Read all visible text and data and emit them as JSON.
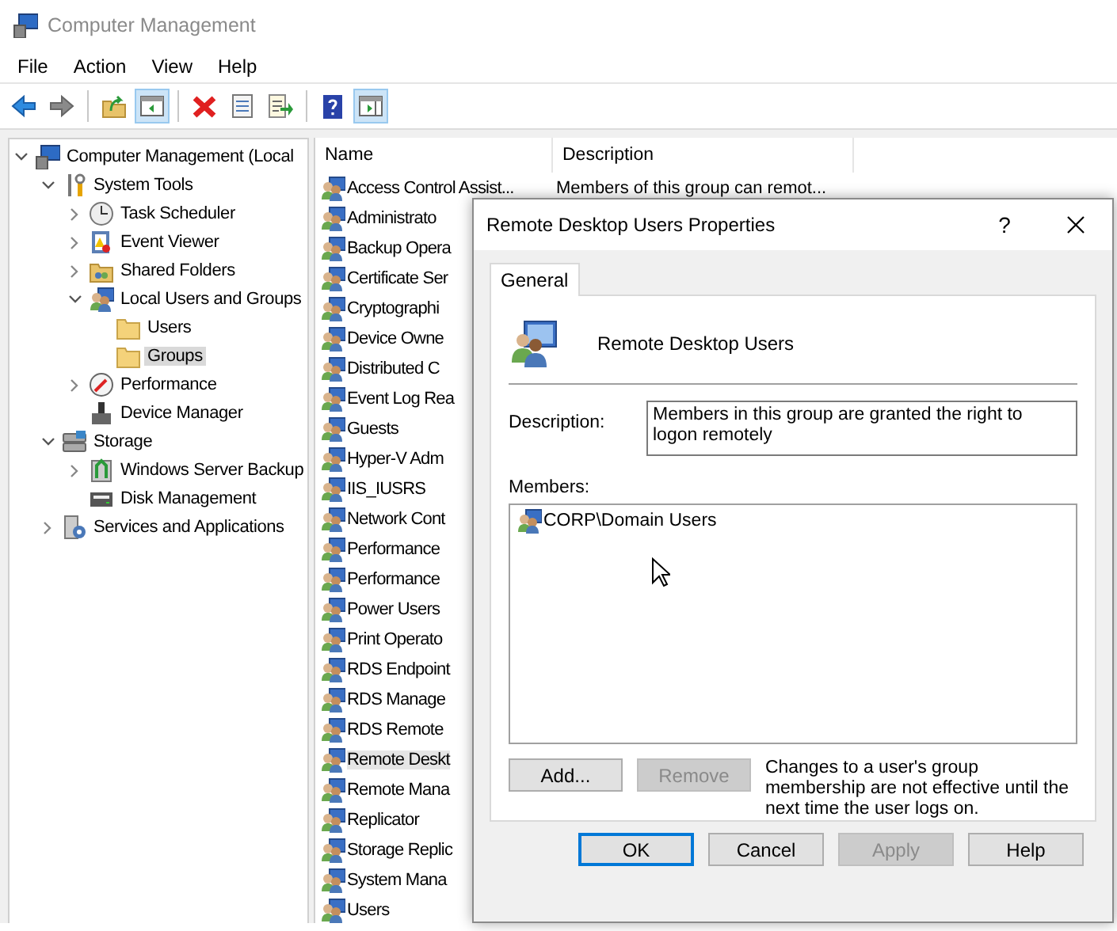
{
  "window": {
    "title": "Computer Management"
  },
  "menu": [
    "File",
    "Action",
    "View",
    "Help"
  ],
  "toolbar": [
    {
      "kind": "back",
      "pressed": false
    },
    {
      "kind": "forward",
      "pressed": false
    },
    {
      "kind": "sep"
    },
    {
      "kind": "up",
      "pressed": false
    },
    {
      "kind": "tree",
      "pressed": true
    },
    {
      "kind": "sep"
    },
    {
      "kind": "delete",
      "pressed": false
    },
    {
      "kind": "properties",
      "pressed": false
    },
    {
      "kind": "export",
      "pressed": false
    },
    {
      "kind": "sep"
    },
    {
      "kind": "help",
      "pressed": false
    },
    {
      "kind": "actions",
      "pressed": true
    }
  ],
  "tree": [
    {
      "label": "Computer Management (Local",
      "kind": "computer",
      "selected": false,
      "expanded": true,
      "children": [
        {
          "label": "System Tools",
          "kind": "tools",
          "selected": false,
          "expanded": true,
          "children": [
            {
              "label": "Task Scheduler",
              "kind": "clock",
              "selected": false,
              "expanded": false
            },
            {
              "label": "Event Viewer",
              "kind": "log",
              "selected": false,
              "expanded": false
            },
            {
              "label": "Shared Folders",
              "kind": "share",
              "selected": false,
              "expanded": false
            },
            {
              "label": "Local Users and Groups",
              "kind": "users",
              "selected": false,
              "expanded": true,
              "children": [
                {
                  "label": "Users",
                  "kind": "folder",
                  "selected": false
                },
                {
                  "label": "Groups",
                  "kind": "folder",
                  "selected": true
                }
              ]
            },
            {
              "label": "Performance",
              "kind": "gauge",
              "selected": false,
              "expanded": false
            },
            {
              "label": "Device Manager",
              "kind": "device",
              "selected": false
            }
          ]
        },
        {
          "label": "Storage",
          "kind": "storage",
          "selected": false,
          "expanded": true,
          "children": [
            {
              "label": "Windows Server Backup",
              "kind": "backup",
              "selected": false,
              "expanded": false
            },
            {
              "label": "Disk Management",
              "kind": "disk",
              "selected": false
            }
          ]
        },
        {
          "label": "Services and Applications",
          "kind": "services",
          "selected": false,
          "expanded": false
        }
      ]
    }
  ],
  "table": {
    "columns": [
      "Name",
      "Description"
    ],
    "rows": [
      {
        "name": "Access Control Assist...",
        "description": "Members of this group can remot...",
        "selected": false
      },
      {
        "name": "Administrato",
        "selected": false
      },
      {
        "name": "Backup Opera",
        "selected": false
      },
      {
        "name": "Certificate Ser",
        "selected": false
      },
      {
        "name": "Cryptographi",
        "selected": false
      },
      {
        "name": "Device Owne",
        "selected": false
      },
      {
        "name": "Distributed C",
        "selected": false
      },
      {
        "name": "Event Log Rea",
        "selected": false
      },
      {
        "name": "Guests",
        "selected": false
      },
      {
        "name": "Hyper-V Adm",
        "selected": false
      },
      {
        "name": "IIS_IUSRS",
        "selected": false
      },
      {
        "name": "Network Cont",
        "selected": false
      },
      {
        "name": "Performance",
        "selected": false
      },
      {
        "name": "Performance",
        "selected": false
      },
      {
        "name": "Power Users",
        "selected": false
      },
      {
        "name": "Print Operato",
        "selected": false
      },
      {
        "name": "RDS Endpoint",
        "selected": false
      },
      {
        "name": "RDS Manage",
        "selected": false
      },
      {
        "name": "RDS Remote",
        "selected": false
      },
      {
        "name": "Remote Deskt",
        "selected": true
      },
      {
        "name": "Remote Mana",
        "selected": false
      },
      {
        "name": "Replicator",
        "selected": false
      },
      {
        "name": "Storage Replic",
        "selected": false
      },
      {
        "name": "System Mana",
        "selected": false
      },
      {
        "name": "Users",
        "selected": false
      }
    ]
  },
  "dialog": {
    "title": "Remote Desktop Users Properties",
    "help": "?",
    "tabs": [
      {
        "label": "General",
        "selected": true
      }
    ],
    "group_name": "Remote Desktop Users",
    "description_label": "Description:",
    "description": "Members in this group are granted the right to logon remotely",
    "members_label": "Members:",
    "members": [
      {
        "name": "CORP\\Domain Users",
        "selected": false
      }
    ],
    "member_buttons": [
      {
        "label": "Add...",
        "disabled": false
      },
      {
        "label": "Remove",
        "disabled": true
      }
    ],
    "note": "Changes to a user's group membership are not effective until the next time the user logs on.",
    "buttons": [
      {
        "label": "OK",
        "default": true,
        "disabled": false
      },
      {
        "label": "Cancel",
        "default": false,
        "disabled": false
      },
      {
        "label": "Apply",
        "default": false,
        "disabled": true
      },
      {
        "label": "Help",
        "default": false,
        "disabled": false
      }
    ]
  }
}
